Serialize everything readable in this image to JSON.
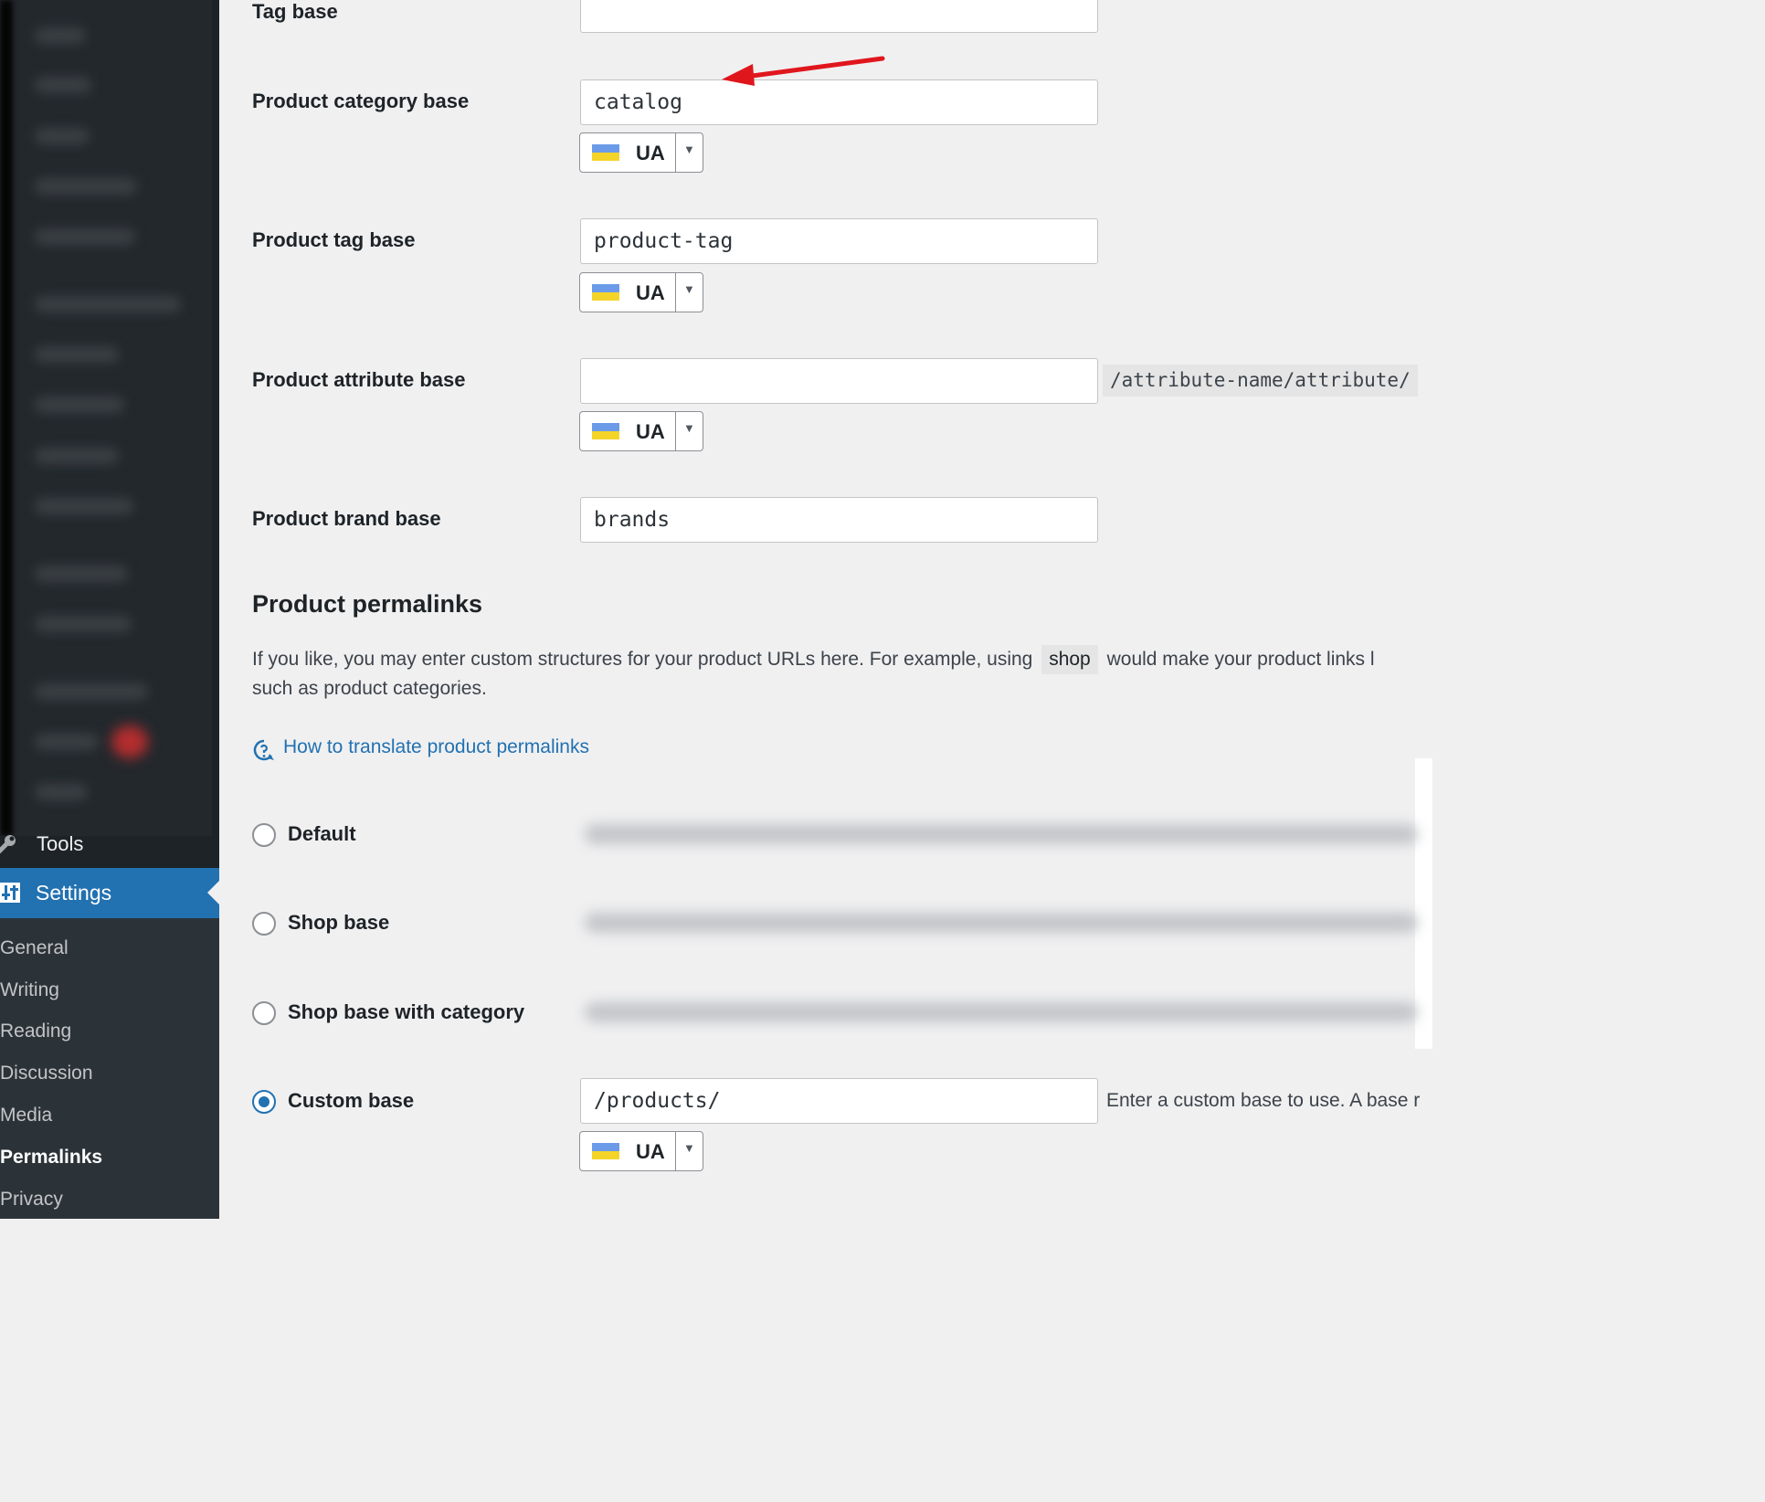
{
  "sidebar": {
    "tools_label": "Tools",
    "settings_label": "Settings",
    "submenu": [
      {
        "label": "General",
        "current": false
      },
      {
        "label": "Writing",
        "current": false
      },
      {
        "label": "Reading",
        "current": false
      },
      {
        "label": "Discussion",
        "current": false
      },
      {
        "label": "Media",
        "current": false
      },
      {
        "label": "Permalinks",
        "current": true
      },
      {
        "label": "Privacy",
        "current": false
      }
    ]
  },
  "fields": {
    "tag_base": {
      "label": "Tag base",
      "value": ""
    },
    "product_category_base": {
      "label": "Product category base",
      "value": "catalog",
      "lang": "UA"
    },
    "product_tag_base": {
      "label": "Product tag base",
      "value": "product-tag",
      "lang": "UA"
    },
    "product_attribute_base": {
      "label": "Product attribute base",
      "value": "",
      "suffix": "/attribute-name/attribute/",
      "lang": "UA"
    },
    "product_brand_base": {
      "label": "Product brand base",
      "value": "brands"
    }
  },
  "product_permalinks": {
    "title": "Product permalinks",
    "description_before": "If you like, you may enter custom structures for your product URLs here. For example, using",
    "description_code": "shop",
    "description_after": "would make your product links l",
    "description_line2": "such as product categories.",
    "help_link": "How to translate product permalinks",
    "options": {
      "default": "Default",
      "shop_base": "Shop base",
      "shop_base_category": "Shop base with category",
      "custom_base": "Custom base"
    },
    "selected": "custom_base",
    "custom_value": "/products/",
    "custom_hint": "Enter a custom base to use. A base r",
    "custom_lang": "UA"
  },
  "colors": {
    "accent": "#2271b1",
    "sidebar": "#1d2327",
    "arrow": "#e0161d"
  }
}
